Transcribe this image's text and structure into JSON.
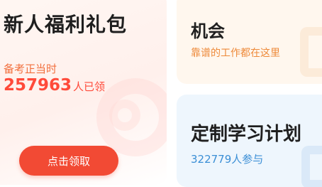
{
  "welfare_card": {
    "title": "新人福利礼包",
    "subtitle": "备考正当时",
    "count": "257963",
    "count_suffix": "人已领",
    "button_label": "点击领取",
    "accent_color": "#f24a34"
  },
  "opportunity_card": {
    "title": "机会",
    "subtitle": "靠谱的工作都在这里",
    "accent_color": "#ee8a3a"
  },
  "study_plan_card": {
    "title": "定制学习计划",
    "subtitle": "322779人参与",
    "accent_color": "#3b8fd6"
  }
}
